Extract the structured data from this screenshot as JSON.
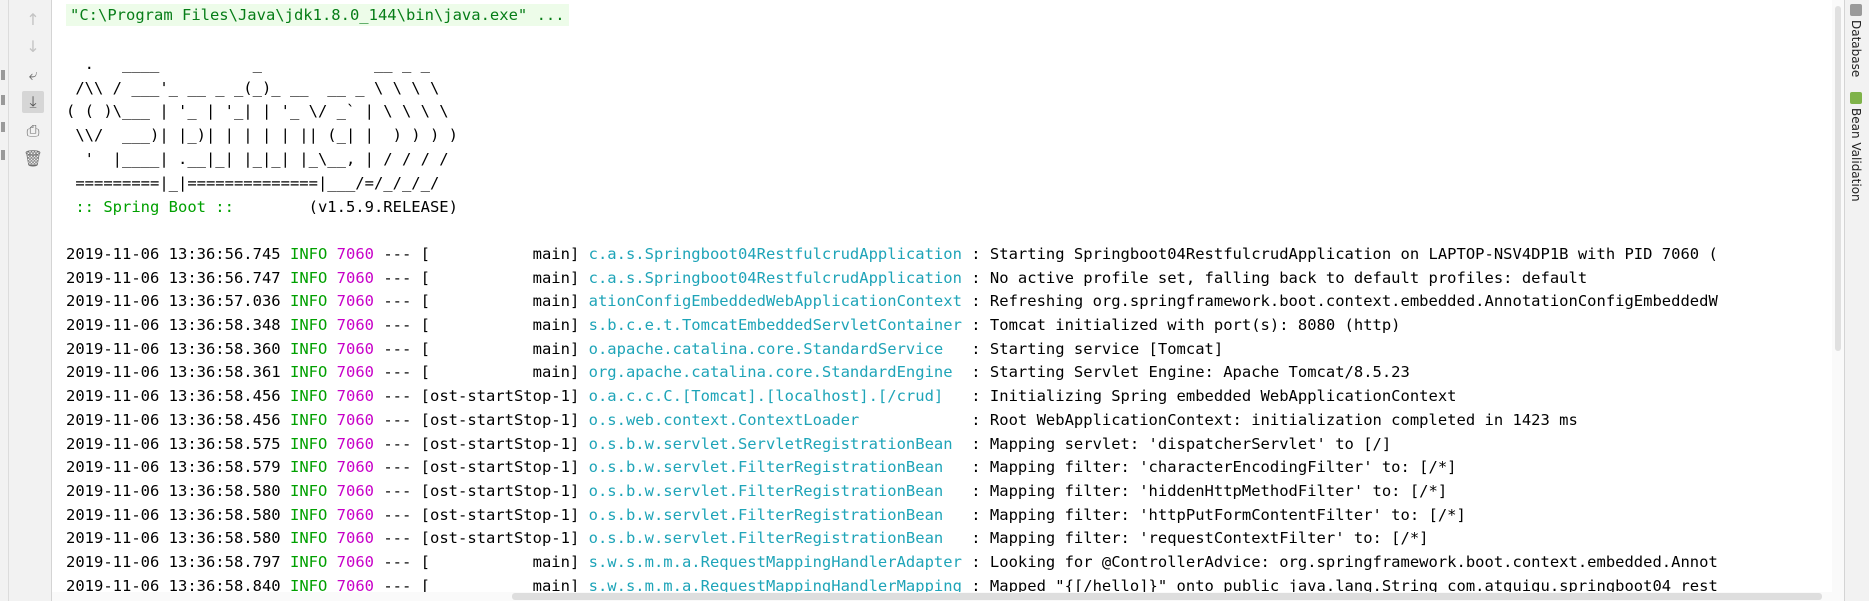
{
  "toolbar": {
    "tools": [
      {
        "name": "up-arrow-icon",
        "glyph": "↑"
      },
      {
        "name": "down-arrow-icon",
        "glyph": "↓"
      },
      {
        "name": "soft-wrap-icon",
        "glyph": "⤶"
      },
      {
        "name": "scroll-to-end-icon",
        "glyph": "⤓"
      },
      {
        "name": "print-icon",
        "glyph": "⎙"
      },
      {
        "name": "trash-icon",
        "glyph": "🗑"
      }
    ]
  },
  "console": {
    "command": "\"C:\\Program Files\\Java\\jdk1.8.0_144\\bin\\java.exe\" ...",
    "banner_art": "  .   ____          _            __ _ _\n /\\\\ / ___'_ __ _ _(_)_ __  __ _ \\ \\ \\ \\\n( ( )\\___ | '_ | '_| | '_ \\/ _` | \\ \\ \\ \\\n \\\\/  ___)| |_)| | | | | || (_| |  ) ) ) )\n  '  |____| .__|_| |_|_| |_\\__, | / / / /\n =========|_|==============|___/=/_/_/_/",
    "banner_name": " :: Spring Boot :: ",
    "banner_version": "       (v1.5.9.RELEASE)",
    "log_rows": [
      {
        "ts": "2019-11-06 13:36:56.745",
        "level": "INFO",
        "pid": "7060",
        "sep": " --- ",
        "thread": "[           main]",
        "logger": "c.a.s.Springboot04RestfulcrudApplication",
        "message": " : Starting Springboot04RestfulcrudApplication on LAPTOP-NSV4DP1B with PID 7060 ("
      },
      {
        "ts": "2019-11-06 13:36:56.747",
        "level": "INFO",
        "pid": "7060",
        "sep": " --- ",
        "thread": "[           main]",
        "logger": "c.a.s.Springboot04RestfulcrudApplication",
        "message": " : No active profile set, falling back to default profiles: default"
      },
      {
        "ts": "2019-11-06 13:36:57.036",
        "level": "INFO",
        "pid": "7060",
        "sep": " --- ",
        "thread": "[           main]",
        "logger": "ationConfigEmbeddedWebApplicationContext",
        "message": " : Refreshing org.springframework.boot.context.embedded.AnnotationConfigEmbeddedW"
      },
      {
        "ts": "2019-11-06 13:36:58.348",
        "level": "INFO",
        "pid": "7060",
        "sep": " --- ",
        "thread": "[           main]",
        "logger": "s.b.c.e.t.TomcatEmbeddedServletContainer",
        "message": " : Tomcat initialized with port(s): 8080 (http)"
      },
      {
        "ts": "2019-11-06 13:36:58.360",
        "level": "INFO",
        "pid": "7060",
        "sep": " --- ",
        "thread": "[           main]",
        "logger": "o.apache.catalina.core.StandardService  ",
        "message": " : Starting service [Tomcat]"
      },
      {
        "ts": "2019-11-06 13:36:58.361",
        "level": "INFO",
        "pid": "7060",
        "sep": " --- ",
        "thread": "[           main]",
        "logger": "org.apache.catalina.core.StandardEngine ",
        "message": " : Starting Servlet Engine: Apache Tomcat/8.5.23"
      },
      {
        "ts": "2019-11-06 13:36:58.456",
        "level": "INFO",
        "pid": "7060",
        "sep": " --- ",
        "thread": "[ost-startStop-1]",
        "logger": "o.a.c.c.C.[Tomcat].[localhost].[/crud]  ",
        "message": " : Initializing Spring embedded WebApplicationContext"
      },
      {
        "ts": "2019-11-06 13:36:58.456",
        "level": "INFO",
        "pid": "7060",
        "sep": " --- ",
        "thread": "[ost-startStop-1]",
        "logger": "o.s.web.context.ContextLoader           ",
        "message": " : Root WebApplicationContext: initialization completed in 1423 ms"
      },
      {
        "ts": "2019-11-06 13:36:58.575",
        "level": "INFO",
        "pid": "7060",
        "sep": " --- ",
        "thread": "[ost-startStop-1]",
        "logger": "o.s.b.w.servlet.ServletRegistrationBean ",
        "message": " : Mapping servlet: 'dispatcherServlet' to [/]"
      },
      {
        "ts": "2019-11-06 13:36:58.579",
        "level": "INFO",
        "pid": "7060",
        "sep": " --- ",
        "thread": "[ost-startStop-1]",
        "logger": "o.s.b.w.servlet.FilterRegistrationBean  ",
        "message": " : Mapping filter: 'characterEncodingFilter' to: [/*]"
      },
      {
        "ts": "2019-11-06 13:36:58.580",
        "level": "INFO",
        "pid": "7060",
        "sep": " --- ",
        "thread": "[ost-startStop-1]",
        "logger": "o.s.b.w.servlet.FilterRegistrationBean  ",
        "message": " : Mapping filter: 'hiddenHttpMethodFilter' to: [/*]"
      },
      {
        "ts": "2019-11-06 13:36:58.580",
        "level": "INFO",
        "pid": "7060",
        "sep": " --- ",
        "thread": "[ost-startStop-1]",
        "logger": "o.s.b.w.servlet.FilterRegistrationBean  ",
        "message": " : Mapping filter: 'httpPutFormContentFilter' to: [/*]"
      },
      {
        "ts": "2019-11-06 13:36:58.580",
        "level": "INFO",
        "pid": "7060",
        "sep": " --- ",
        "thread": "[ost-startStop-1]",
        "logger": "o.s.b.w.servlet.FilterRegistrationBean  ",
        "message": " : Mapping filter: 'requestContextFilter' to: [/*]"
      },
      {
        "ts": "2019-11-06 13:36:58.797",
        "level": "INFO",
        "pid": "7060",
        "sep": " --- ",
        "thread": "[           main]",
        "logger": "s.w.s.m.m.a.RequestMappingHandlerAdapter",
        "message": " : Looking for @ControllerAdvice: org.springframework.boot.context.embedded.Annot"
      },
      {
        "ts": "2019-11-06 13:36:58.840",
        "level": "INFO",
        "pid": "7060",
        "sep": " --- ",
        "thread": "[           main]",
        "logger": "s.w.s.m.m.a.RequestMappingHandlerMapping",
        "message": " : Mapped \"{[/hello]}\" onto public java.lang.String com.atguigu.springboot04_rest"
      }
    ]
  },
  "right_panel": {
    "tabs": [
      {
        "label": "Database",
        "icon": "database-icon"
      },
      {
        "label": "Bean Validation",
        "icon": "bean-validation-icon"
      }
    ]
  },
  "colors": {
    "command_bg": "#edfce9",
    "command_text": "#067d17",
    "level_info": "#00a000",
    "pid": "#c800c8",
    "logger": "#1ea4b8"
  }
}
